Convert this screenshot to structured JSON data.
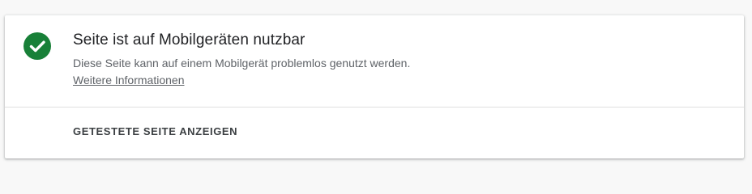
{
  "result": {
    "title": "Seite ist auf Mobilgeräten nutzbar",
    "description": "Diese Seite kann auf einem Mobilgerät problemlos genutzt werden.",
    "more_link": "Weitere Informationen",
    "status_icon": "check-circle-icon",
    "status_color": "#188038"
  },
  "actions": {
    "view_tested_page": "GETESTETE SEITE ANZEIGEN"
  }
}
